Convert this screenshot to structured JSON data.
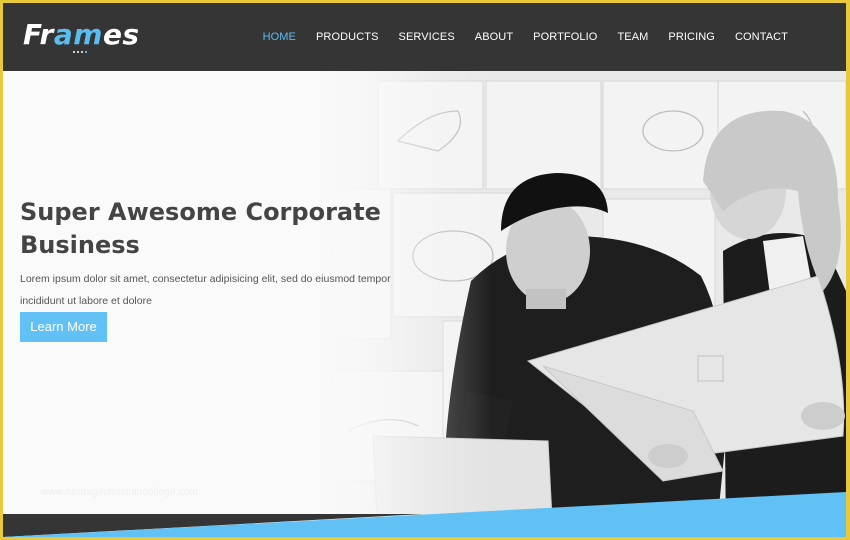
{
  "header": {
    "logo": {
      "part1": "Fr",
      "part2": "am",
      "part3": "es"
    },
    "nav": [
      {
        "label": "HOME",
        "active": true
      },
      {
        "label": "PRODUCTS",
        "active": false
      },
      {
        "label": "SERVICES",
        "active": false
      },
      {
        "label": "ABOUT",
        "active": false
      },
      {
        "label": "PORTFOLIO",
        "active": false
      },
      {
        "label": "TEAM",
        "active": false
      },
      {
        "label": "PRICING",
        "active": false
      },
      {
        "label": "CONTACT",
        "active": false
      }
    ]
  },
  "hero": {
    "title": "Super Awesome Corporate Business",
    "description": "Lorem ipsum dolor sit amet, consectetur adipisicing elit, sed do eiusmod tempor incididunt ut labore et dolore",
    "button_label": "Learn More",
    "watermark": "www.heritagechristiancollege.com",
    "image_description": "grayscale photo of two colleagues reviewing design sketches"
  },
  "colors": {
    "accent": "#62c1f4",
    "header_bg": "#353535",
    "frame_border": "#e7c93a",
    "title_text": "#444444"
  }
}
